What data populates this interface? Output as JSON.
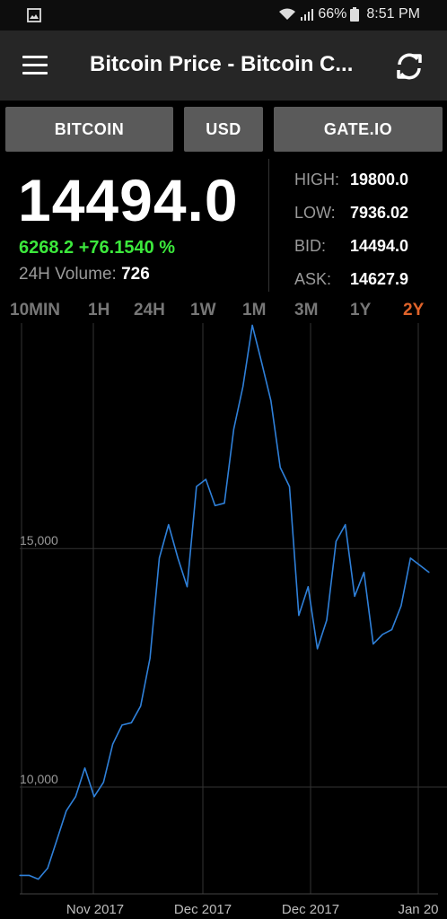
{
  "statusbar": {
    "battery": "66%",
    "time": "8:51 PM"
  },
  "appbar": {
    "title": "Bitcoin Price - Bitcoin C..."
  },
  "selectors": {
    "coin": "BITCOIN",
    "currency": "USD",
    "exchange": "GATE.IO"
  },
  "ticker": {
    "price": "14494.0",
    "change": "6268.2 +76.1540 %",
    "volume_label": "24H Volume:",
    "volume_value": "726",
    "high_label": "HIGH:",
    "high_value": "19800.0",
    "low_label": "LOW:",
    "low_value": "7936.02",
    "bid_label": "BID:",
    "bid_value": "14494.0",
    "ask_label": "ASK:",
    "ask_value": "14627.9"
  },
  "ranges": [
    "10MIN",
    "1H",
    "24H",
    "1W",
    "1M",
    "3M",
    "1Y",
    "2Y"
  ],
  "active_range": "2Y",
  "colors": {
    "accent": "#e0632a",
    "positive": "#3ce83c",
    "line": "#2f80d9"
  },
  "chart_data": {
    "type": "line",
    "xlabels": [
      "Nov 2017",
      "Dec 2017",
      "Dec 2017",
      "Jan 20"
    ],
    "ylabels": [
      "15,000",
      "10,000"
    ],
    "y_ticks": [
      15000,
      10000
    ],
    "ylim": [
      7800,
      19500
    ],
    "series": [
      {
        "values": [
          8150,
          8150,
          8070,
          8300,
          8900,
          9500,
          9800,
          10400,
          9800,
          10100,
          10900,
          11300,
          11350,
          11700,
          12700,
          14800,
          15500,
          14800,
          14200,
          16300,
          16450,
          15900,
          15950,
          17500,
          18400,
          19680,
          18900,
          18100,
          16700,
          16300,
          13600,
          14200,
          12900,
          13500,
          15150,
          15500,
          14000,
          14500,
          13000,
          13200,
          13300,
          13800,
          14800,
          14650,
          14500
        ]
      }
    ]
  }
}
